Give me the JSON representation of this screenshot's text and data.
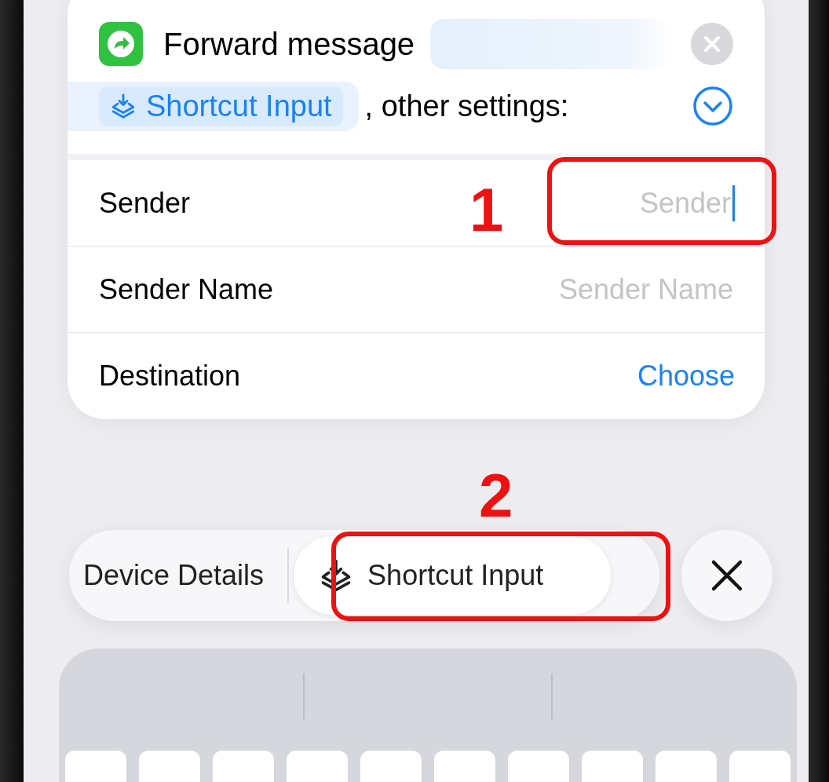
{
  "action": {
    "title": "Forward message",
    "token": "Shortcut Input",
    "suffix": ", other settings:",
    "expanded": true
  },
  "fields": [
    {
      "kind": "input",
      "label": "Sender",
      "placeholder": "Sender",
      "focused": true
    },
    {
      "kind": "input",
      "label": "Sender Name",
      "placeholder": "Sender Name",
      "focused": false
    },
    {
      "kind": "picker",
      "label": "Destination",
      "value": "Choose"
    }
  ],
  "variable_bar": {
    "items": [
      {
        "label": "Device Details",
        "selected": false,
        "icon": false
      },
      {
        "label": "Shortcut Input",
        "selected": true,
        "icon": true
      }
    ]
  },
  "annotations": [
    {
      "label": "1"
    },
    {
      "label": "2"
    }
  ]
}
